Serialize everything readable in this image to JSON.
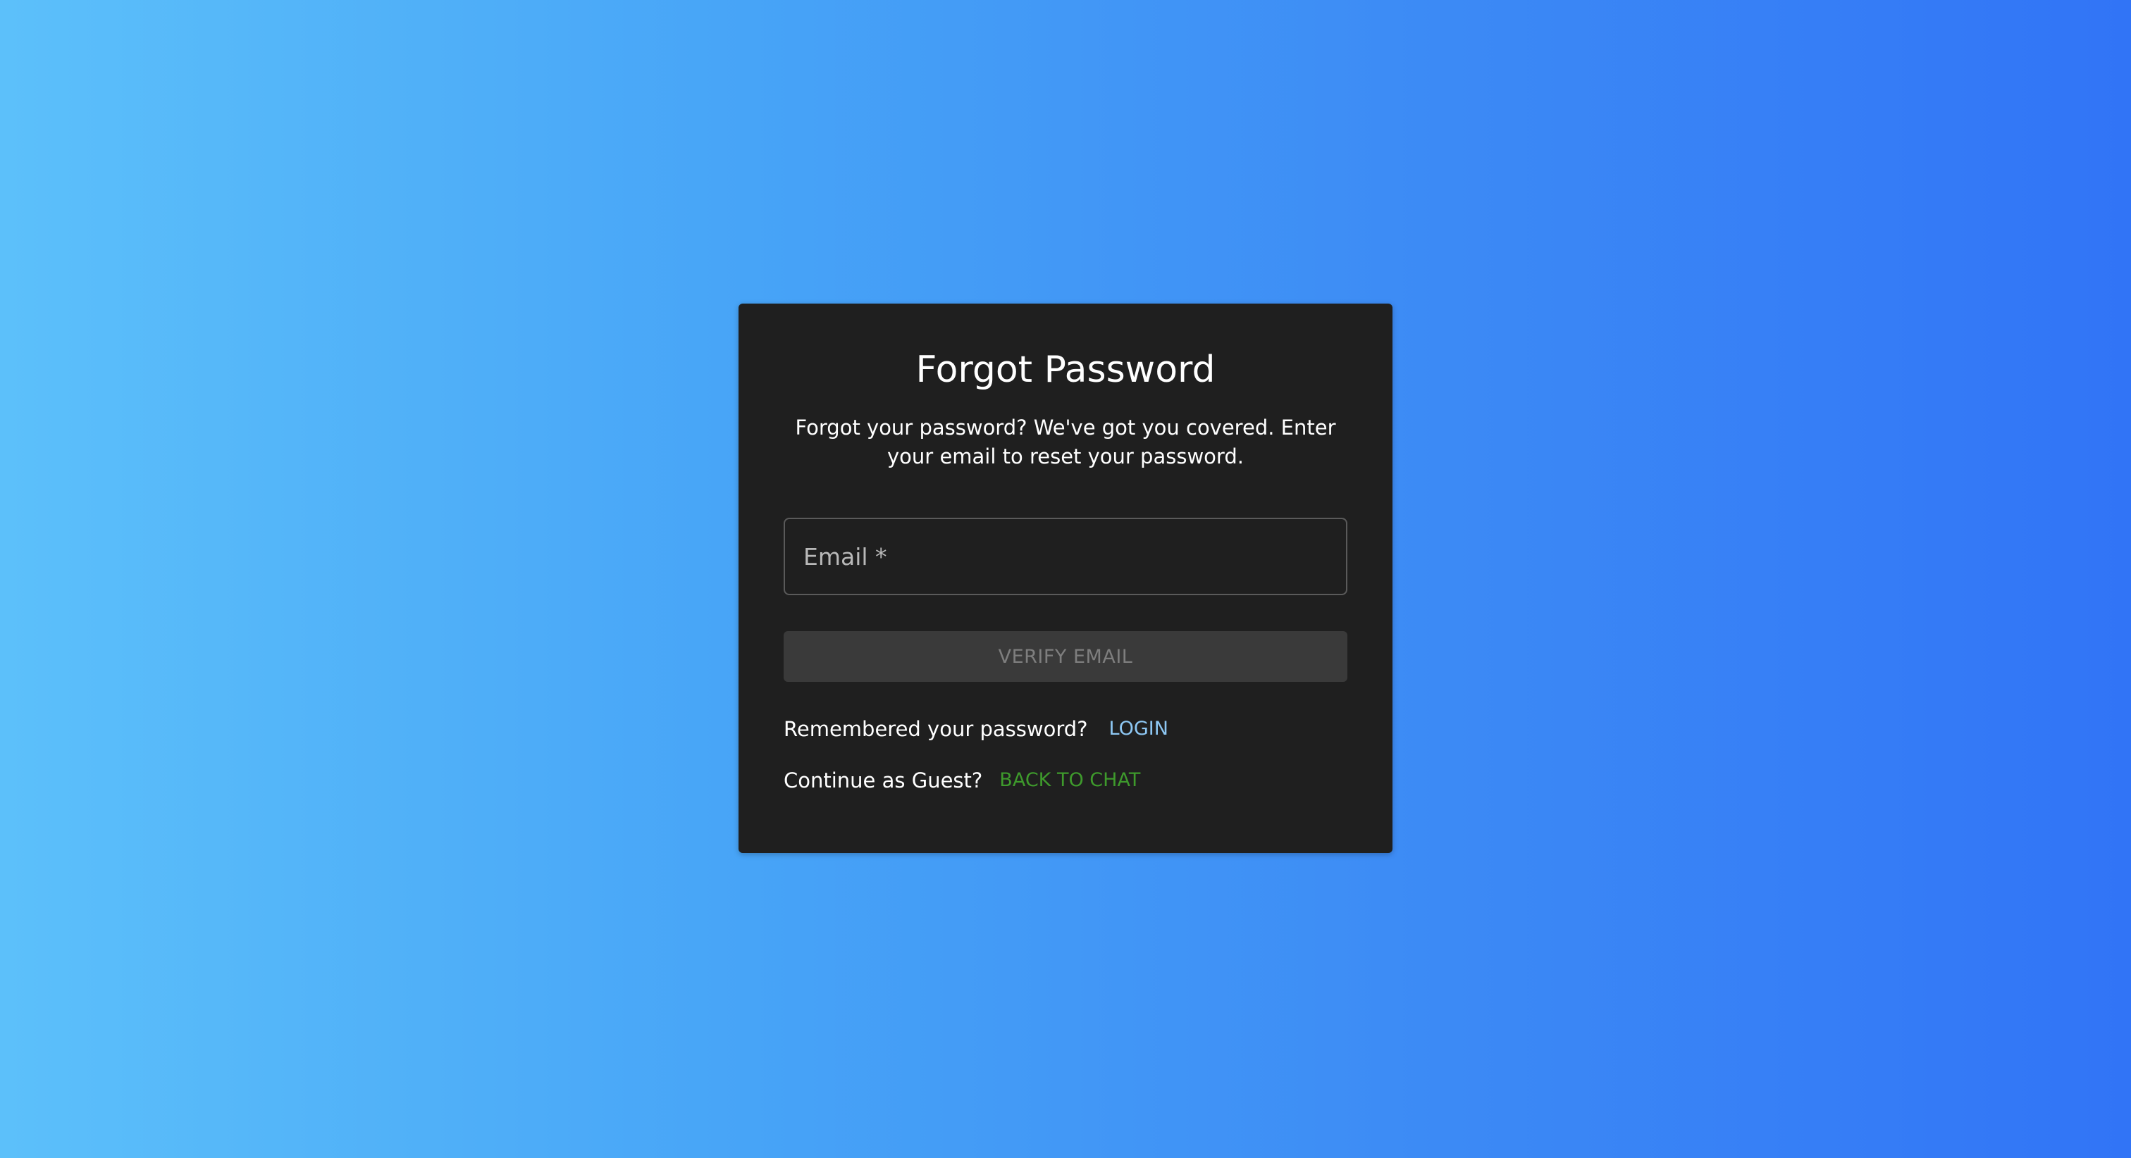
{
  "forgot_password": {
    "title": "Forgot Password",
    "subtitle": "Forgot your password? We've got you covered. Enter your email to reset your password.",
    "email_field": {
      "placeholder": "Email *",
      "value": ""
    },
    "verify_button_label": "VERIFY EMAIL",
    "remembered": {
      "text": "Remembered your password?",
      "link_label": "LOGIN"
    },
    "guest": {
      "text": "Continue as Guest?",
      "link_label": "BACK TO CHAT"
    }
  },
  "colors": {
    "background_gradient_start": "#5cc0fa",
    "background_gradient_end": "#3174f6",
    "card_background": "#1f1f1f",
    "login_link": "#8ec8f4",
    "back_to_chat_link": "#3e9a2c",
    "disabled_button": "#3a3a3a"
  }
}
